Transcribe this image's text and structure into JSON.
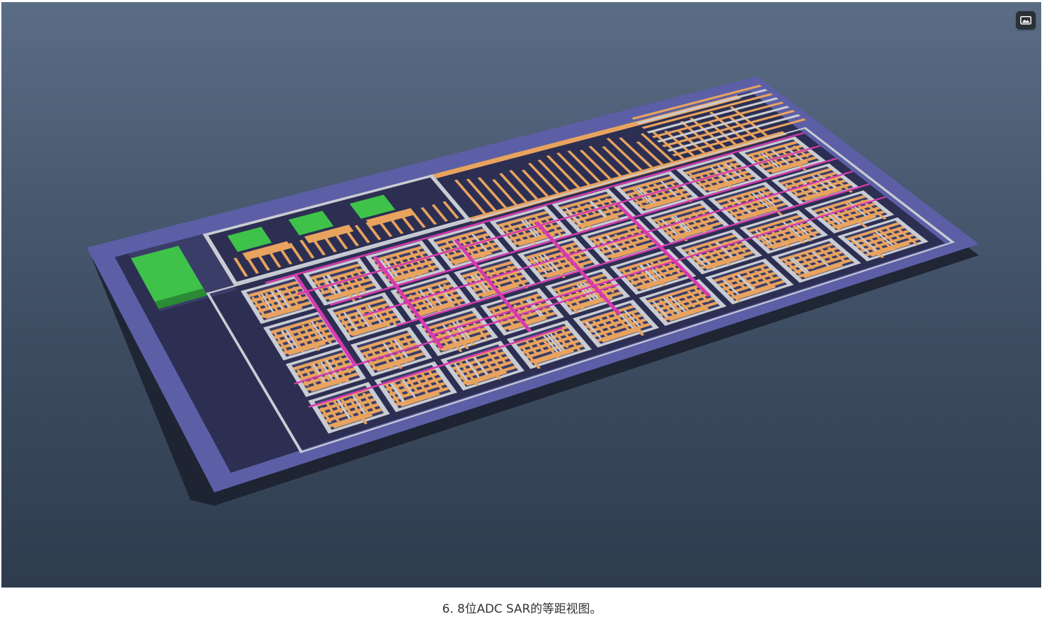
{
  "figure": {
    "alt": "",
    "image_button_icon": "image-icon",
    "colors": {
      "background_top": "#5b6d85",
      "background_bottom": "#2f3c4e",
      "substrate": "#5c5fa6",
      "metal_orange": "#e8a35f",
      "metal_gray": "#c9ccd2",
      "metal_magenta": "#d83ab0",
      "metal_green": "#3fc24a"
    }
  },
  "caption": "6. 8位ADC SAR的等距视图。"
}
